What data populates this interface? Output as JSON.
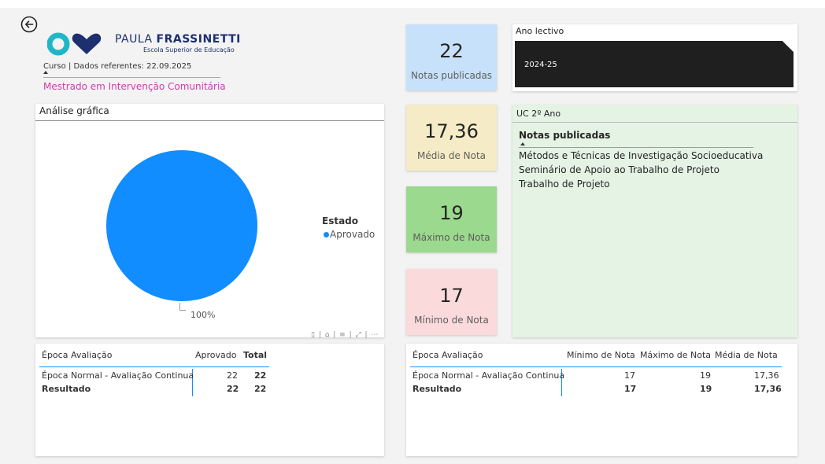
{
  "header": {
    "brand_name_light": "PAULA ",
    "brand_name_bold": "FRASSINETTI",
    "brand_subtitle": "Escola Superior de Educação",
    "course_label": "Curso | Dados referentes: 22.09.2025",
    "course_value": "Mestrado em Intervenção Comunitária"
  },
  "chart_panel": {
    "title": "Análise gráfica",
    "legend_title": "Estado",
    "toolbar_glyphs": "▯ | ⌂ | ≡ | ⤢ | ⋯"
  },
  "chart_data": {
    "type": "pie",
    "categories": [
      "Aprovado"
    ],
    "values": [
      100
    ],
    "data_labels": [
      "100%"
    ],
    "legend_title": "Estado",
    "legend_position": "right",
    "colors": [
      "#118dff"
    ]
  },
  "table1": {
    "headers": [
      "Época Avaliação",
      "Aprovado",
      "Total"
    ],
    "rows": [
      [
        "Época Normal - Avaliação Continua",
        "22",
        "22"
      ]
    ],
    "total": [
      "Resultado",
      "22",
      "22"
    ]
  },
  "kpis": [
    {
      "value": "22",
      "label": "Notas publicadas",
      "color": "#c7e1fb"
    },
    {
      "value": "17,36",
      "label": "Média de Nota",
      "color": "#f5ebc6"
    },
    {
      "value": "19",
      "label": "Máximo de Nota",
      "color": "#9ad98e"
    },
    {
      "value": "17",
      "label": "Mínimo de Nota",
      "color": "#fadada"
    }
  ],
  "ano_lectivo": {
    "title": "Ano lectivo",
    "value": "2024-25"
  },
  "uc": {
    "title": "UC 2º Ano",
    "header": "Notas publicadas",
    "items": [
      "Métodos e Técnicas de Investigação Socioeducativa",
      "Seminário de Apoio ao Trabalho de Projeto",
      "Trabalho de Projeto"
    ]
  },
  "table2": {
    "headers": [
      "Época Avaliação",
      "Mínimo de Nota",
      "Máximo de Nota",
      "Média de Nota"
    ],
    "rows": [
      [
        "Época Normal - Avaliação Continua",
        "17",
        "19",
        "17,36"
      ]
    ],
    "total": [
      "Resultado",
      "17",
      "19",
      "17,36"
    ]
  },
  "colors": {
    "accent": "#118dff",
    "brand_dark": "#1d2f6f",
    "brand_teal": "#1fb7c7",
    "course_pink": "#c83ea8"
  }
}
